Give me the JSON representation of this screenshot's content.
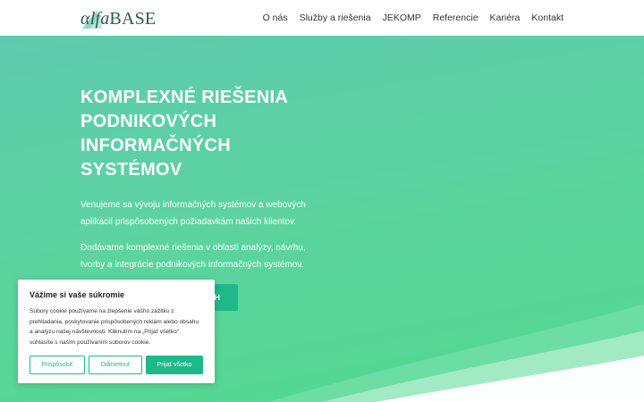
{
  "header": {
    "logo": {
      "prefix": "αlfa",
      "suffix": "BASE"
    },
    "nav": [
      {
        "label": "O nás"
      },
      {
        "label": "Služby a riešenia"
      },
      {
        "label": "JEKOMP"
      },
      {
        "label": "Referencie"
      },
      {
        "label": "Kariéra"
      },
      {
        "label": "Kontakt"
      }
    ]
  },
  "hero": {
    "title": "KOMPLEXNÉ RIEŠENIA PODNIKOVÝCH INFORMAČNÝCH SYSTÉMOV",
    "paragraph1": "Venujeme sa vývoju informačných systémov a webových aplikácií prispôsobených požiadavkám našich klientov.",
    "paragraph2": "Dodávame komplexné riešenia v oblasti analýzy, návrhu, tvorby a integrácie podnikových informačných systémov.",
    "button_label": "H"
  },
  "cookie": {
    "title": "Vážime si vaše súkromie",
    "text": "Súbory cookie používame na zlepšenie vášho zážitku z prehliadania, poskytovanie prispôsobených reklám alebo obsahu a analýzu našej návštevnosti. Kliknutím na „Prijať všetko“ súhlasíte s naším používaním súborov cookie.",
    "customize_label": "Prispôsobiť",
    "reject_label": "Odmietnuť",
    "accept_label": "Prijať všetko"
  },
  "colors": {
    "accent": "#1db98a",
    "hero_gradient_start": "#5ecbae",
    "hero_gradient_end": "#52d98f"
  }
}
